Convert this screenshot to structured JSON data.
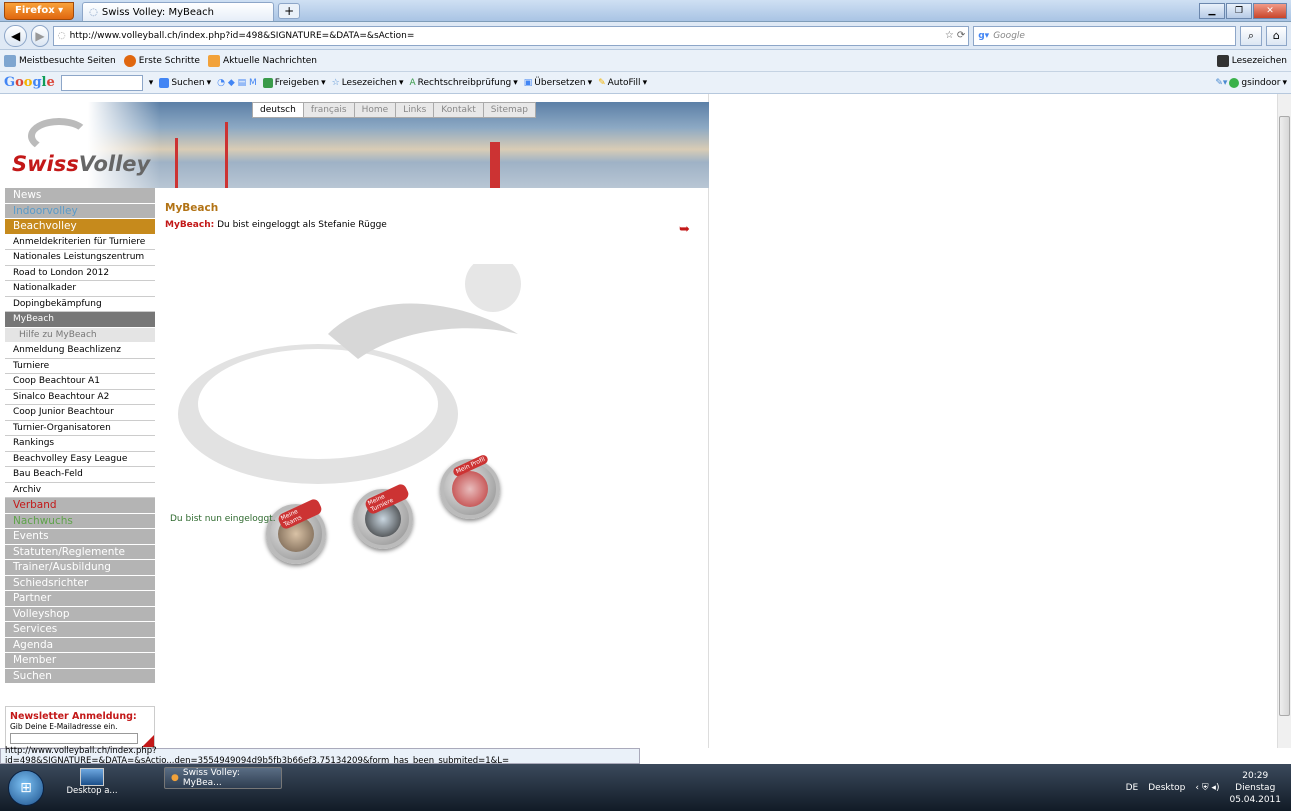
{
  "browser": {
    "app_button": "Firefox",
    "tab_title": "Swiss Volley: MyBeach",
    "url": "http://www.volleyball.ch/index.php?id=498&SIGNATURE=&DATA=&sAction=",
    "search_placeholder": "Google",
    "bookmarks": [
      "Meistbesuchte Seiten",
      "Erste Schritte",
      "Aktuelle Nachrichten"
    ],
    "bookmarks_right": "Lesezeichen",
    "google_logo": "Google",
    "google_toolbar": [
      "Suchen",
      "Freigeben",
      "Lesezeichen",
      "Rechtschreibprüfung",
      "Übersetzen",
      "AutoFill"
    ],
    "google_user": "gsindoor"
  },
  "site": {
    "logo_swiss": "Swiss",
    "logo_volley": "Volley",
    "topnav": [
      "deutsch",
      "français",
      "Home",
      "Links",
      "Kontakt",
      "Sitemap"
    ],
    "sidebar": [
      {
        "label": "News",
        "type": "main"
      },
      {
        "label": "Indoorvolley",
        "type": "indoor"
      },
      {
        "label": "Beachvolley",
        "type": "beach"
      },
      {
        "label": "Anmeldekriterien für Turniere",
        "type": "sub"
      },
      {
        "label": "Nationales Leistungszentrum",
        "type": "sub"
      },
      {
        "label": "Road to London 2012",
        "type": "sub"
      },
      {
        "label": "Nationalkader",
        "type": "sub"
      },
      {
        "label": "Dopingbekämpfung",
        "type": "sub"
      },
      {
        "label": "MyBeach",
        "type": "sel"
      },
      {
        "label": "Hilfe zu MyBeach",
        "type": "subsub"
      },
      {
        "label": "Anmeldung Beachlizenz",
        "type": "sub"
      },
      {
        "label": "Turniere",
        "type": "sub"
      },
      {
        "label": "Coop Beachtour A1",
        "type": "sub"
      },
      {
        "label": "Sinalco Beachtour A2",
        "type": "sub"
      },
      {
        "label": "Coop Junior Beachtour",
        "type": "sub"
      },
      {
        "label": "Turnier-Organisatoren",
        "type": "sub"
      },
      {
        "label": "Rankings",
        "type": "sub"
      },
      {
        "label": "Beachvolley Easy League",
        "type": "sub"
      },
      {
        "label": "Bau Beach-Feld",
        "type": "sub"
      },
      {
        "label": "Archiv",
        "type": "sub"
      },
      {
        "label": "Verband",
        "type": "verband"
      },
      {
        "label": "Nachwuchs",
        "type": "nach"
      },
      {
        "label": "Events",
        "type": "main"
      },
      {
        "label": "Statuten/Reglemente",
        "type": "main"
      },
      {
        "label": "Trainer/Ausbildung",
        "type": "main"
      },
      {
        "label": "Schiedsrichter",
        "type": "main"
      },
      {
        "label": "Partner",
        "type": "main"
      },
      {
        "label": "Volleyshop",
        "type": "main"
      },
      {
        "label": "Services",
        "type": "main"
      },
      {
        "label": "Agenda",
        "type": "main"
      },
      {
        "label": "Member",
        "type": "main"
      },
      {
        "label": "Suchen",
        "type": "main"
      }
    ],
    "newsletter_title": "Newsletter Anmeldung:",
    "newsletter_sub": "Gib Deine E-Mailadresse ein.",
    "main_title": "MyBeach",
    "main_label": "MyBeach:",
    "main_text": "Du bist eingeloggt als Stefanie Rügge",
    "medallions": [
      "Meine Teams",
      "Meine Turniere",
      "Mein Profil"
    ],
    "logged_in": "Du bist nun eingeloggt."
  },
  "status_url": "http://www.volleyball.ch/index.php?id=498&SIGNATURE=&DATA=&sActio...den=3554949094d9b5fb3b66ef3.75134209&form_has_been_submited=1&L=",
  "taskbar": {
    "desktop_label": "Desktop a...",
    "task": "Swiss Volley: MyBea...",
    "lang": "DE",
    "desktop": "Desktop",
    "time": "20:29",
    "day": "Dienstag",
    "date": "05.04.2011"
  }
}
